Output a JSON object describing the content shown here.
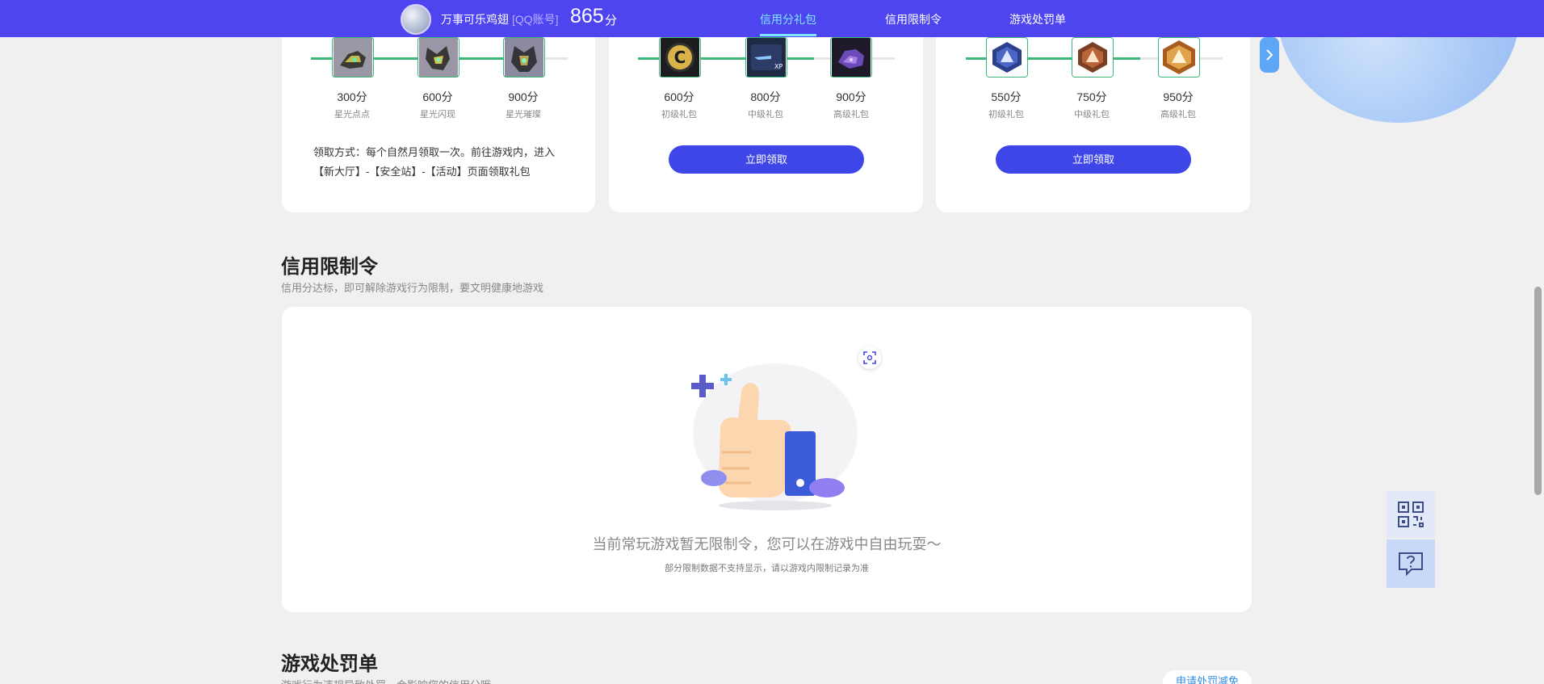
{
  "header": {
    "username": "万事可乐鸡翅",
    "account_type": "[QQ账号]",
    "score": "865",
    "score_unit": "分",
    "tabs": [
      {
        "label": "信用分礼包",
        "active": true
      },
      {
        "label": "信用限制令",
        "active": false
      },
      {
        "label": "游戏处罚单",
        "active": false
      }
    ]
  },
  "gift_cards": [
    {
      "rewards": [
        {
          "points": "300分",
          "name": "星光点点",
          "icon": "mecha-pet-icon"
        },
        {
          "points": "600分",
          "name": "星光闪现",
          "icon": "mecha-pet-icon"
        },
        {
          "points": "900分",
          "name": "星光璀璨",
          "icon": "mecha-pet-icon"
        }
      ],
      "note": "领取方式：每个自然月领取一次。前往游戏内，进入【新大厅】-【安全站】-【活动】页面领取礼包"
    },
    {
      "rewards": [
        {
          "points": "600分",
          "name": "初级礼包",
          "icon": "coin-c-icon"
        },
        {
          "points": "800分",
          "name": "中级礼包",
          "icon": "xp-card-icon"
        },
        {
          "points": "900分",
          "name": "高级礼包",
          "icon": "purple-pet-icon"
        }
      ],
      "button": "立即领取"
    },
    {
      "rewards": [
        {
          "points": "550分",
          "name": "初级礼包",
          "icon": "rank-badge-blue-icon"
        },
        {
          "points": "750分",
          "name": "中级礼包",
          "icon": "rank-badge-bronze-icon"
        },
        {
          "points": "950分",
          "name": "高级礼包",
          "icon": "rank-badge-gold-icon"
        }
      ],
      "button": "立即领取"
    }
  ],
  "restriction": {
    "title": "信用限制令",
    "subtitle": "信用分达标，即可解除游戏行为限制，要文明健康地游戏",
    "empty_main": "当前常玩游戏暂无限制令，您可以在游戏中自由玩耍～",
    "empty_sub": "部分限制数据不支持显示，请以游戏内限制记录为准"
  },
  "penalty": {
    "title": "游戏处罚单",
    "subtitle": "游戏行为违规导致处罚，会影响您的信用分哦",
    "appeal_button": "申请处罚减免"
  },
  "colors": {
    "header_bg": "#4e44f0",
    "active_tab": "#7fe7ff",
    "button_bg": "#3f46e8",
    "progress_green": "#3bb879"
  }
}
